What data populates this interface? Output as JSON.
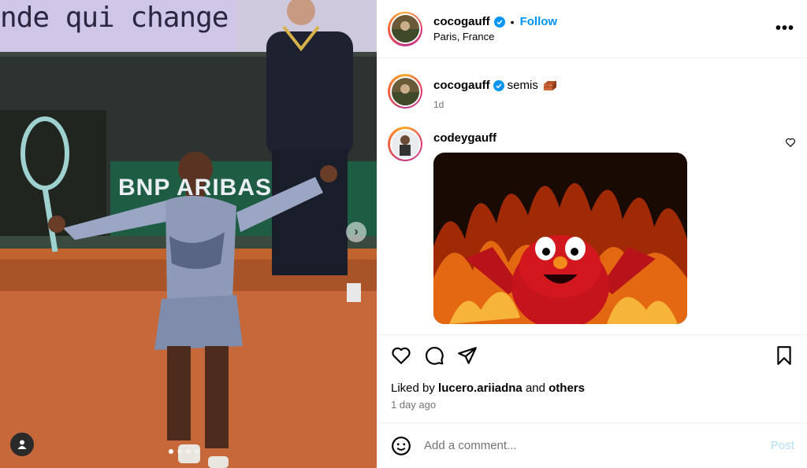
{
  "media": {
    "banner_text": "nde qui change",
    "sponsor_text": "BNP ARIBAS",
    "next_icon": "chevron-right-icon",
    "user_tag_icon": "person-icon",
    "carousel": {
      "count": 4,
      "active_index": 0
    }
  },
  "header": {
    "username": "cocogauff",
    "verified_icon": "verified-badge-icon",
    "separator": "•",
    "follow_label": "Follow",
    "location": "Paris, France",
    "more_icon": "more-horizontal-icon",
    "more_label": "•••"
  },
  "caption": {
    "username": "cocogauff",
    "text": "semis",
    "emoji_icon": "brick-emoji-icon",
    "time": "1d"
  },
  "comment": {
    "username": "codeygauff",
    "gif_icon": "elmo-fire-gif",
    "like_icon": "heart-icon"
  },
  "actions": {
    "like_icon": "heart-icon",
    "comment_icon": "comment-icon",
    "share_icon": "send-icon",
    "save_icon": "bookmark-icon"
  },
  "likes": {
    "prefix": "Liked by",
    "user": "lucero.ariiadna",
    "and": "and",
    "others": "others"
  },
  "post_time": "1 day ago",
  "comment_box": {
    "emoji_icon": "emoji-icon",
    "placeholder": "Add a comment...",
    "post_label": "Post"
  },
  "colors": {
    "link_blue": "#0095f6",
    "post_disabled": "#b2dffc",
    "secondary_text": "#737373",
    "clay_court": "#c0632f"
  }
}
